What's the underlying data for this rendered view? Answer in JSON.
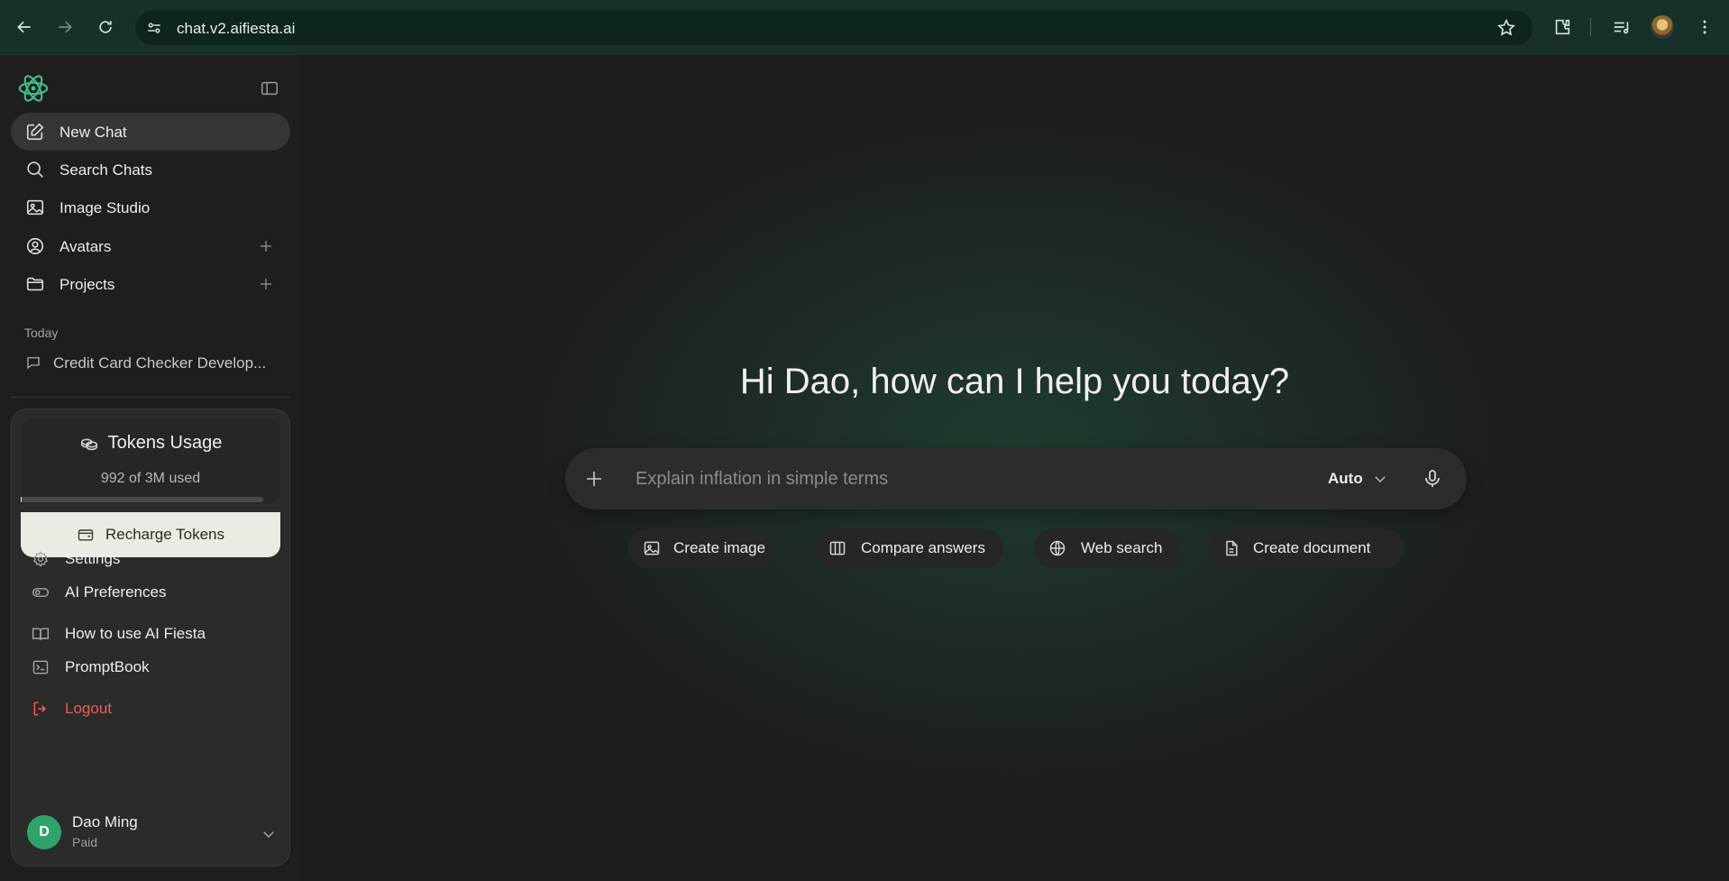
{
  "browser": {
    "url": "chat.v2.aifiesta.ai"
  },
  "sidebar": {
    "nav": [
      {
        "label": "New Chat",
        "icon": "edit-icon"
      },
      {
        "label": "Search Chats",
        "icon": "search-icon"
      },
      {
        "label": "Image Studio",
        "icon": "image-icon"
      },
      {
        "label": "Avatars",
        "icon": "user-circle-icon"
      },
      {
        "label": "Projects",
        "icon": "folder-icon"
      }
    ],
    "history_section": "Today",
    "history": [
      {
        "label": "Credit Card Checker Develop..."
      }
    ]
  },
  "menu": {
    "tokens_title": "Tokens Usage",
    "tokens_used": "992 of 3M used",
    "tokens_fraction": 0.00033,
    "recharge_label": "Recharge Tokens",
    "items": [
      {
        "label": "Settings"
      },
      {
        "label": "AI Preferences"
      },
      {
        "label": "How to use AI Fiesta"
      },
      {
        "label": "PromptBook"
      }
    ],
    "logout_label": "Logout",
    "user": {
      "initial": "D",
      "name": "Dao Ming",
      "plan": "Paid"
    }
  },
  "main": {
    "greeting": "Hi Dao, how can I help you today?",
    "input_placeholder": "Explain inflation in simple terms",
    "model": "Auto",
    "chips": [
      {
        "label": "Create image"
      },
      {
        "label": "Compare answers"
      },
      {
        "label": "Web search"
      },
      {
        "label": "Create document"
      }
    ]
  },
  "colors": {
    "accent": "#3fbf8a",
    "danger": "#ef5b58",
    "avatar": "#2fa36b"
  }
}
